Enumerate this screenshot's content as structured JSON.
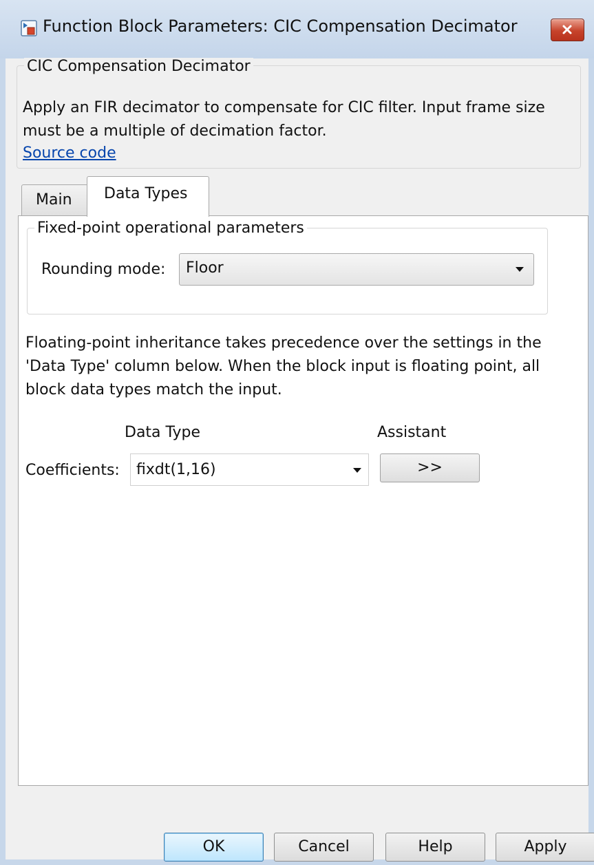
{
  "window": {
    "title": "Function Block Parameters: CIC Compensation Decimator"
  },
  "description": {
    "group_title": "CIC Compensation Decimator",
    "text": "Apply an FIR decimator to compensate for CIC filter. Input frame size must be a multiple of decimation factor.",
    "source_link": "Source code"
  },
  "tabs": [
    {
      "label": "Main",
      "active": false
    },
    {
      "label": "Data Types",
      "active": true
    }
  ],
  "fixed_point": {
    "group_title": "Fixed-point operational parameters",
    "rounding_label": "Rounding mode:",
    "rounding_value": "Floor"
  },
  "info_text": "Floating-point inheritance takes precedence over the settings in the 'Data Type' column below. When the block input is floating point, all block data types match the input.",
  "table": {
    "col_data_type": "Data Type",
    "col_assistant": "Assistant",
    "row_label": "Coefficients:",
    "row_value": "fixdt(1,16)",
    "assistant_button": ">>"
  },
  "buttons": {
    "ok": "OK",
    "cancel": "Cancel",
    "help": "Help",
    "apply": "Apply"
  }
}
